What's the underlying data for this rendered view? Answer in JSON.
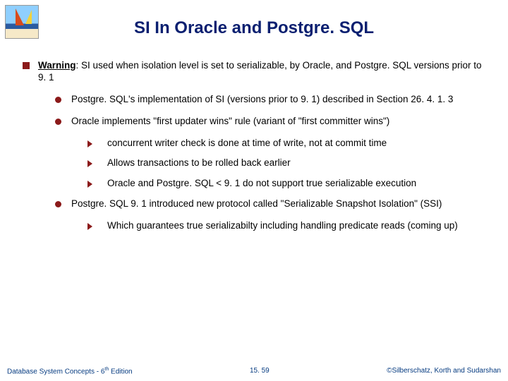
{
  "title": "SI In Oracle and Postgre. SQL",
  "warning_label": "Warning",
  "warning_text": ": SI used when isolation level is set to serializable, by Oracle, and Postgre. SQL versions prior to 9. 1",
  "b1": "Postgre. SQL's implementation of SI (versions prior to 9. 1) described in Section 26. 4. 1. 3",
  "b2": "Oracle implements \"first updater wins\" rule (variant of \"first committer wins\")",
  "b2_1": "concurrent writer check is done at time of write, not at commit time",
  "b2_2": "Allows transactions to be rolled back earlier",
  "b2_3": "Oracle and Postgre. SQL < 9. 1 do not support true serializable execution",
  "b3": "Postgre. SQL 9. 1 introduced new protocol called \"Serializable Snapshot Isolation\" (SSI)",
  "b3_1": "Which guarantees true serializabilty including handling predicate reads (coming up)",
  "footer_left_a": "Database System Concepts - 6",
  "footer_left_b": "th",
  "footer_left_c": " Edition",
  "footer_center": "15. 59",
  "footer_right": "©Silberschatz, Korth and Sudarshan"
}
